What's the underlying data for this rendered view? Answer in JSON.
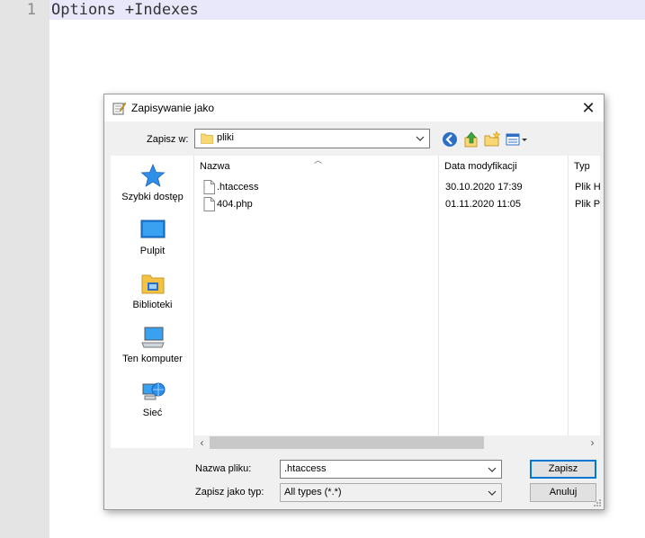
{
  "editor": {
    "line_number": "1",
    "code": "Options +Indexes"
  },
  "dialog": {
    "title": "Zapisywanie jako",
    "save_in_label": "Zapisz w:",
    "save_in_value": "pliki",
    "places": [
      {
        "label": "Szybki dostęp",
        "icon": "star-icon"
      },
      {
        "label": "Pulpit",
        "icon": "desktop-icon"
      },
      {
        "label": "Biblioteki",
        "icon": "libraries-icon"
      },
      {
        "label": "Ten komputer",
        "icon": "computer-icon"
      },
      {
        "label": "Sieć",
        "icon": "network-icon"
      }
    ],
    "columns": [
      "Nazwa",
      "Data modyfikacji",
      "Typ"
    ],
    "files": [
      {
        "name": ".htaccess",
        "date": "30.10.2020 17:39",
        "type": "Plik H"
      },
      {
        "name": "404.php",
        "date": "01.11.2020 11:05",
        "type": "Plik P"
      }
    ],
    "filename_label": "Nazwa pliku:",
    "filename_value": ".htaccess",
    "filetype_label": "Zapisz jako typ:",
    "filetype_value": "All types (*.*)",
    "save_button": "Zapisz",
    "cancel_button": "Anuluj"
  },
  "colors": {
    "accent": "#0078d7",
    "line_highlight": "#e8e8fa",
    "gutter": "#e4e4e4"
  }
}
